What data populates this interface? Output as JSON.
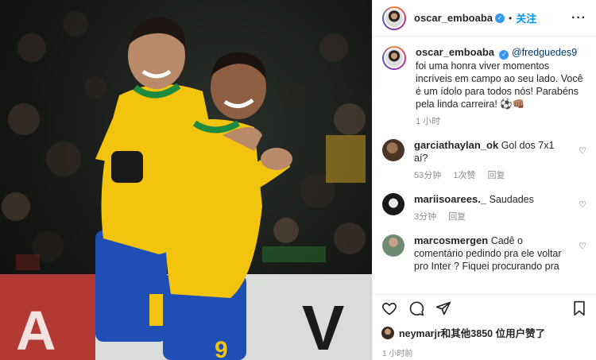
{
  "post": {
    "author": "oscar_emboaba",
    "separator": "•",
    "follow_label": "关注",
    "more_label": "···",
    "icons": {
      "verified": "verified-check-icon",
      "more": "more-options-icon"
    }
  },
  "caption": {
    "author": "oscar_emboaba",
    "mention": "@fredguedes9",
    "text": "foi uma honra viver momentos incríveis em campo ao seu lado. Você é um ídolo para todos nós! Parabéns pela linda carreira! ⚽👊🏽",
    "time": "1 小时"
  },
  "comments": [
    {
      "user": "garciathaylan_ok",
      "text": "Gol dos 7x1 aí?",
      "time": "53分钟",
      "likes": "1次赞",
      "reply": "回复"
    },
    {
      "user": "mariisoarees._",
      "text": "Saudades",
      "time": "3分钟",
      "likes": "",
      "reply": "回复"
    },
    {
      "user": "marcosmergen",
      "text": "Cadê o comentário pedindo pra ele voltar pro Inter ? Fiquei procurando pra",
      "time": "",
      "likes": "",
      "reply": ""
    }
  ],
  "actions": {
    "icons": [
      "heart-icon",
      "comment-icon",
      "share-icon",
      "bookmark-icon"
    ]
  },
  "likes_text": "neymarjr和其他3850 位用户赞了",
  "post_time": "1 小时前",
  "colors": {
    "link_blue": "#0095f6",
    "mention": "#00376b",
    "jersey_yellow": "#f2c40d",
    "jersey_green": "#1d8a3f",
    "shorts_blue": "#1f4fb5"
  }
}
